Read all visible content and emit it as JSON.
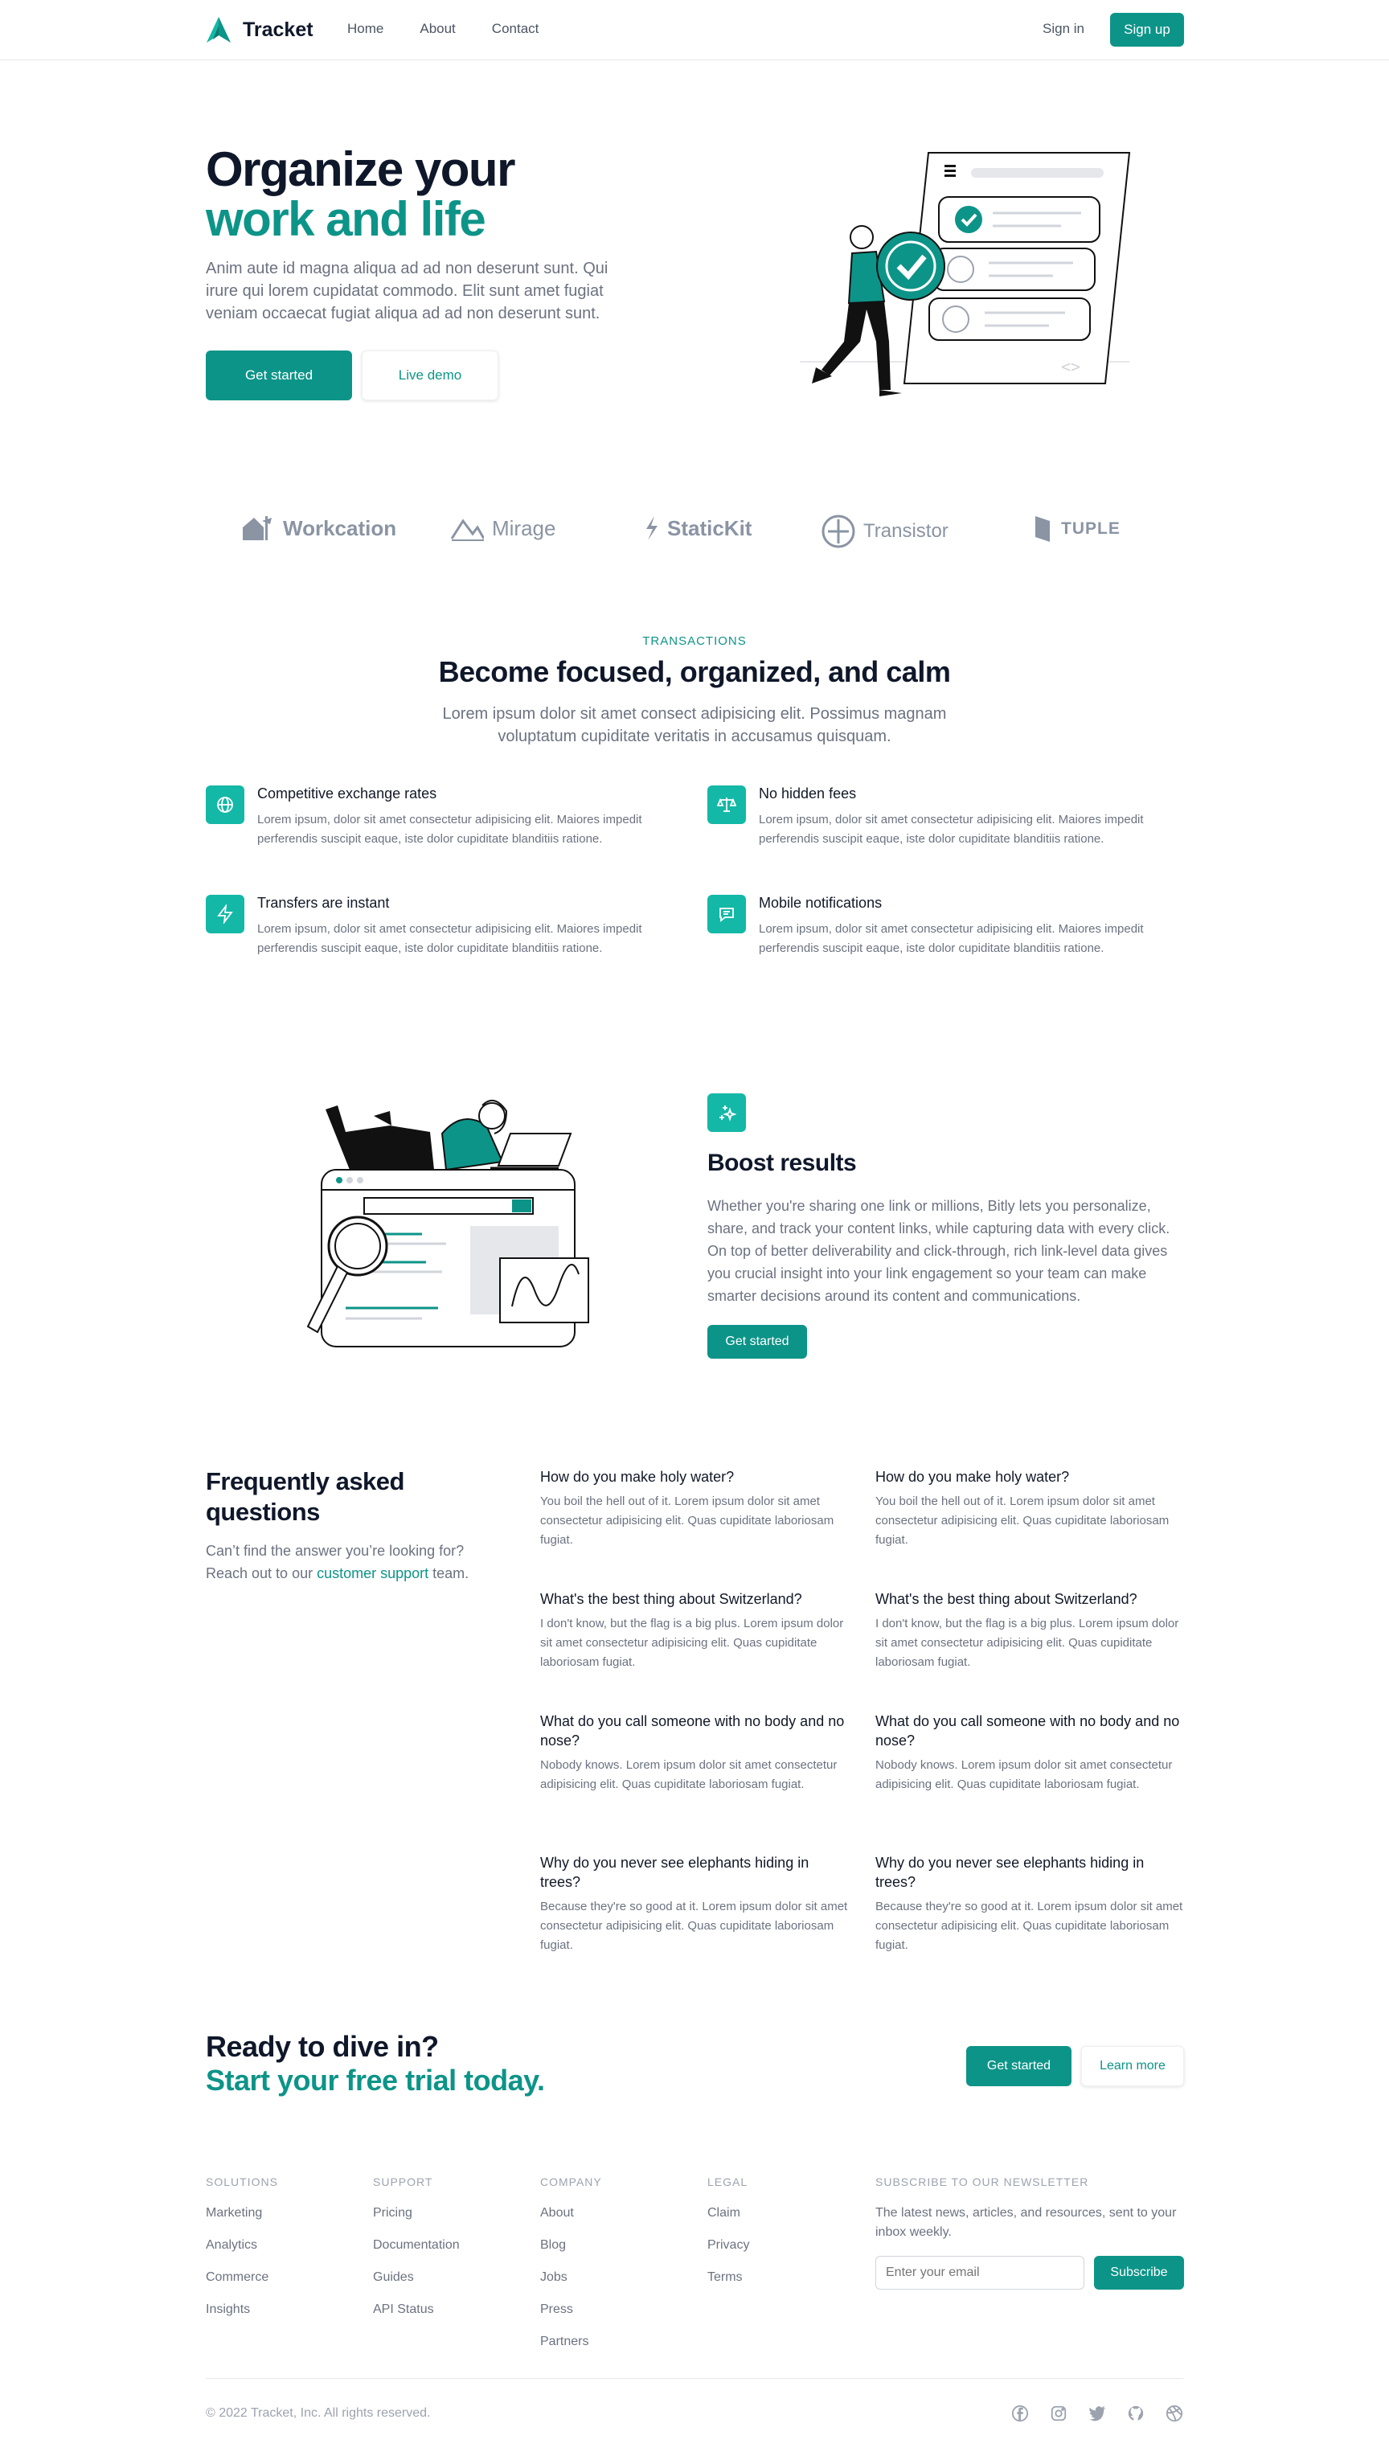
{
  "header": {
    "brand": "Tracket",
    "nav": [
      "Home",
      "About",
      "Contact"
    ],
    "signin": "Sign in",
    "signup": "Sign up"
  },
  "hero": {
    "title_line1": "Organize your",
    "title_line2": "work and life",
    "subtitle": "Anim aute id magna aliqua ad ad non deserunt sunt. Qui irure qui lorem cupidatat commodo. Elit sunt amet fugiat veniam occaecat fugiat aliqua ad ad non deserunt sunt.",
    "primary": "Get started",
    "secondary": "Live demo"
  },
  "logos": [
    {
      "name": "Workcation",
      "icon": "house-icon"
    },
    {
      "name": "Mirage",
      "icon": "mountain-icon"
    },
    {
      "name": "StaticKit",
      "icon": "bolt-icon"
    },
    {
      "name": "Transistor",
      "icon": "circle-cross-icon"
    },
    {
      "name": "TUPLE",
      "icon": "flag-icon"
    }
  ],
  "features": {
    "eyebrow": "TRANSACTIONS",
    "title": "Become focused, organized, and calm",
    "subtitle": "Lorem ipsum dolor sit amet consect adipisicing elit. Possimus magnam voluptatum cupiditate veritatis in accusamus quisquam.",
    "items": [
      {
        "title": "Competitive exchange rates",
        "desc": "Lorem ipsum, dolor sit amet consectetur adipisicing elit. Maiores impedit perferendis suscipit eaque, iste dolor cupiditate blanditiis ratione.",
        "icon": "globe-icon"
      },
      {
        "title": "No hidden fees",
        "desc": "Lorem ipsum, dolor sit amet consectetur adipisicing elit. Maiores impedit perferendis suscipit eaque, iste dolor cupiditate blanditiis ratione.",
        "icon": "scale-icon"
      },
      {
        "title": "Transfers are instant",
        "desc": "Lorem ipsum, dolor sit amet consectetur adipisicing elit. Maiores impedit perferendis suscipit eaque, iste dolor cupiditate blanditiis ratione.",
        "icon": "lightning-icon"
      },
      {
        "title": "Mobile notifications",
        "desc": "Lorem ipsum, dolor sit amet consectetur adipisicing elit. Maiores impedit perferendis suscipit eaque, iste dolor cupiditate blanditiis ratione.",
        "icon": "chat-icon"
      }
    ]
  },
  "boost": {
    "title": "Boost results",
    "desc": "Whether you're sharing one link or millions, Bitly lets you personalize, share, and track your content links, while capturing data with every click. On top of better deliverability and click-through, rich link-level data gives you crucial insight into your link engagement so your team can make smarter decisions around its content and communications.",
    "button": "Get started",
    "icon": "sparkles-icon"
  },
  "faq": {
    "title": "Frequently asked questions",
    "sub_prefix": "Can’t find the answer you’re looking for? Reach out to our ",
    "sub_link": "customer support",
    "sub_suffix": " team.",
    "items": [
      {
        "q": "How do you make holy water?",
        "a": "You boil the hell out of it. Lorem ipsum dolor sit amet consectetur adipisicing elit. Quas cupiditate laboriosam fugiat."
      },
      {
        "q": "How do you make holy water?",
        "a": "You boil the hell out of it. Lorem ipsum dolor sit amet consectetur adipisicing elit. Quas cupiditate laboriosam fugiat."
      },
      {
        "q": "What's the best thing about Switzerland?",
        "a": "I don't know, but the flag is a big plus. Lorem ipsum dolor sit amet consectetur adipisicing elit. Quas cupiditate laboriosam fugiat."
      },
      {
        "q": "What's the best thing about Switzerland?",
        "a": "I don't know, but the flag is a big plus. Lorem ipsum dolor sit amet consectetur adipisicing elit. Quas cupiditate laboriosam fugiat."
      },
      {
        "q": "What do you call someone with no body and no nose?",
        "a": "Nobody knows. Lorem ipsum dolor sit amet consectetur adipisicing elit. Quas cupiditate laboriosam fugiat."
      },
      {
        "q": "What do you call someone with no body and no nose?",
        "a": "Nobody knows. Lorem ipsum dolor sit amet consectetur adipisicing elit. Quas cupiditate laboriosam fugiat."
      },
      {
        "q": "Why do you never see elephants hiding in trees?",
        "a": "Because they're so good at it. Lorem ipsum dolor sit amet consectetur adipisicing elit. Quas cupiditate laboriosam fugiat."
      },
      {
        "q": "Why do you never see elephants hiding in trees?",
        "a": "Because they're so good at it. Lorem ipsum dolor sit amet consectetur adipisicing elit. Quas cupiditate laboriosam fugiat."
      }
    ]
  },
  "cta": {
    "line1": "Ready to dive in?",
    "line2": "Start your free trial today.",
    "primary": "Get started",
    "secondary": "Learn more"
  },
  "footer": {
    "columns": [
      {
        "title": "Solutions",
        "links": [
          "Marketing",
          "Analytics",
          "Commerce",
          "Insights"
        ]
      },
      {
        "title": "Support",
        "links": [
          "Pricing",
          "Documentation",
          "Guides",
          "API Status"
        ]
      },
      {
        "title": "Company",
        "links": [
          "About",
          "Blog",
          "Jobs",
          "Press",
          "Partners"
        ]
      },
      {
        "title": "Legal",
        "links": [
          "Claim",
          "Privacy",
          "Terms"
        ]
      }
    ],
    "newsletter": {
      "title": "Subscribe to our newsletter",
      "text": "The latest news, articles, and resources, sent to your inbox weekly.",
      "placeholder": "Enter your email",
      "button": "Subscribe"
    },
    "copyright": "© 2022 Tracket, Inc. All rights reserved.",
    "social": [
      "facebook-icon",
      "instagram-icon",
      "twitter-icon",
      "github-icon",
      "dribbble-icon"
    ]
  },
  "colors": {
    "accent": "#0d9488",
    "accent_light": "#14b8a6",
    "text": "#0f172a",
    "muted": "#6b7280"
  }
}
